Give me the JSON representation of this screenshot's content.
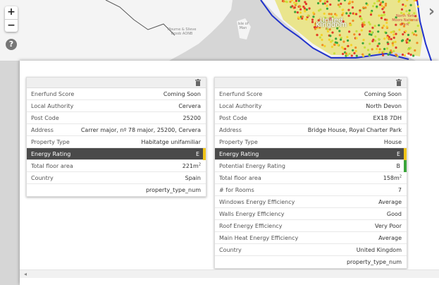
{
  "map": {
    "zoom_in": "+",
    "zoom_out": "−",
    "help": "?",
    "labels": {
      "aonb": "Mourne & Slieve Croob AONB",
      "isle_of_man": "Isle of Man",
      "united_kingdom": "United Kingdom",
      "north_york_moors": "North York Moors National Park"
    }
  },
  "colors": {
    "rating_e": "#f0c419",
    "rating_b": "#3aa53a",
    "boundary": "#2233cc"
  },
  "cards": [
    {
      "rows": [
        {
          "label": "Enerfund Score",
          "value": "Coming Soon"
        },
        {
          "label": "Local Authority",
          "value": "Cervera"
        },
        {
          "label": "Post Code",
          "value": "25200"
        },
        {
          "label": "Address",
          "value": "Carrer major, nº 78 major, 25200, Cervera"
        },
        {
          "label": "Property Type",
          "value": "Habitatge unifamiliar"
        },
        {
          "label": "Energy Rating",
          "value": "E"
        },
        {
          "label": "Total floor area",
          "value": "221m",
          "unit_sup": "2"
        },
        {
          "label": "Country",
          "value": "Spain"
        }
      ],
      "footer": "property_type_num"
    },
    {
      "rows": [
        {
          "label": "Enerfund Score",
          "value": "Coming Soon"
        },
        {
          "label": "Local Authority",
          "value": "North Devon"
        },
        {
          "label": "Post Code",
          "value": "EX18 7DH"
        },
        {
          "label": "Address",
          "value": "Bridge House, Royal Charter Park"
        },
        {
          "label": "Property Type",
          "value": "House"
        },
        {
          "label": "Energy Rating",
          "value": "E"
        },
        {
          "label": "Potential Energy Rating",
          "value": "B"
        },
        {
          "label": "Total floor area",
          "value": "158m",
          "unit_sup": "2"
        },
        {
          "label": "# for Rooms",
          "value": "7"
        },
        {
          "label": "Windows Energy Efficiency",
          "value": "Average"
        },
        {
          "label": "Walls Energy Efficiency",
          "value": "Good"
        },
        {
          "label": "Roof Energy Efficiency",
          "value": "Very Poor"
        },
        {
          "label": "Main Heat Energy Efficiency",
          "value": "Average"
        },
        {
          "label": "Country",
          "value": "United Kingdom"
        }
      ],
      "footer": "property_type_num"
    }
  ],
  "scrollbar": {
    "left_arrow": "◂"
  }
}
